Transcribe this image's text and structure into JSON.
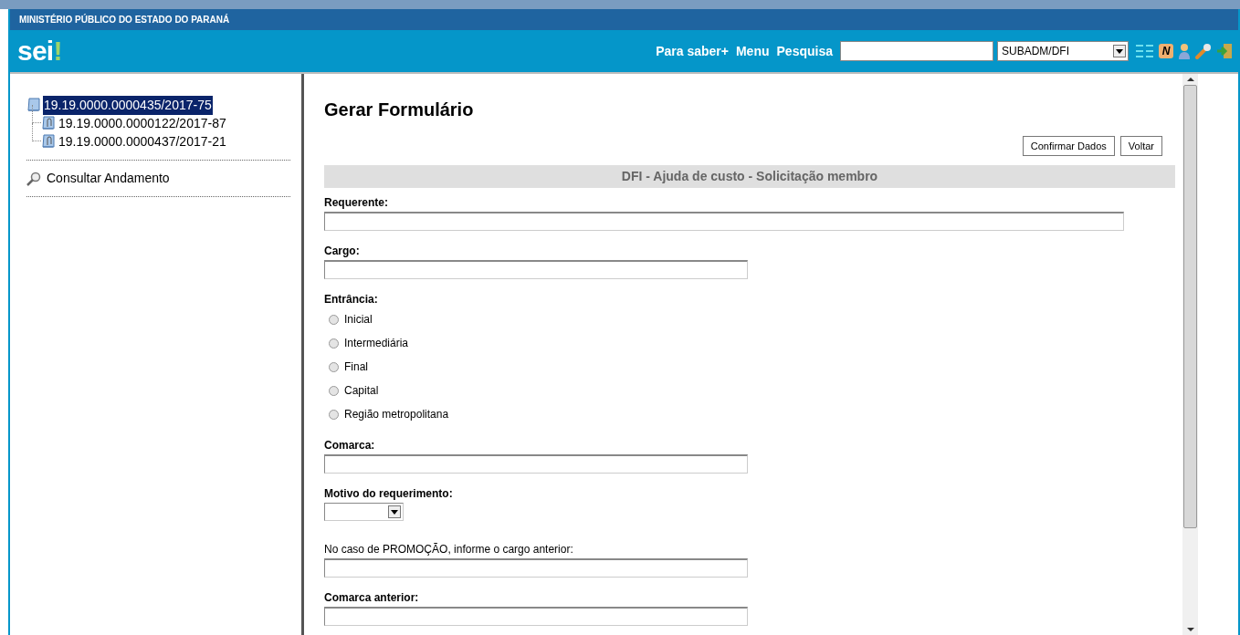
{
  "header": {
    "organization": "MINISTÉRIO PÚBLICO DO ESTADO DO PARANÁ",
    "logo": "sei!",
    "links": [
      "Para saber+",
      "Menu"
    ],
    "search": {
      "label": "Pesquisa"
    },
    "unit_select": {
      "value": "SUBADM/DFI"
    },
    "notes_badge": "N"
  },
  "tree": {
    "label": "19.19.0000.0000435/2017-75",
    "selected": true,
    "children": [
      {
        "label": "19.19.0000.0000122/2017-87",
        "selected": false
      },
      {
        "label": "19.19.0000.0000437/2017-21",
        "selected": false
      }
    ]
  },
  "menu": [
    {
      "label": "Consultar Andamento"
    }
  ],
  "page_title": "Gerar Formulário",
  "buttons": [
    "Confirmar Dados",
    "Voltar"
  ],
  "form_title": "DFI - Ajuda de custo - Solicitação membro",
  "fields": [
    {
      "kind": "text",
      "label": "Requerente:",
      "required": true
    },
    {
      "kind": "text",
      "label": "Cargo:",
      "required": true
    },
    {
      "kind": "radio",
      "label": "Entrância:",
      "required": true,
      "options": [
        {
          "label": "Inicial",
          "selected": false
        },
        {
          "label": "Intermediária",
          "selected": false
        },
        {
          "label": "Final",
          "selected": false
        },
        {
          "label": "Capital",
          "selected": false
        },
        {
          "label": "Região metropolitana",
          "selected": false
        }
      ]
    },
    {
      "kind": "text",
      "label": "Comarca:",
      "required": true
    },
    {
      "kind": "select",
      "label": "Motivo do requerimento:",
      "required": true
    },
    {
      "kind": "text",
      "label": "No caso de PROMOÇÃO, informe o cargo anterior:",
      "required": false
    },
    {
      "kind": "text",
      "label": "Comarca anterior:",
      "required": true
    }
  ]
}
